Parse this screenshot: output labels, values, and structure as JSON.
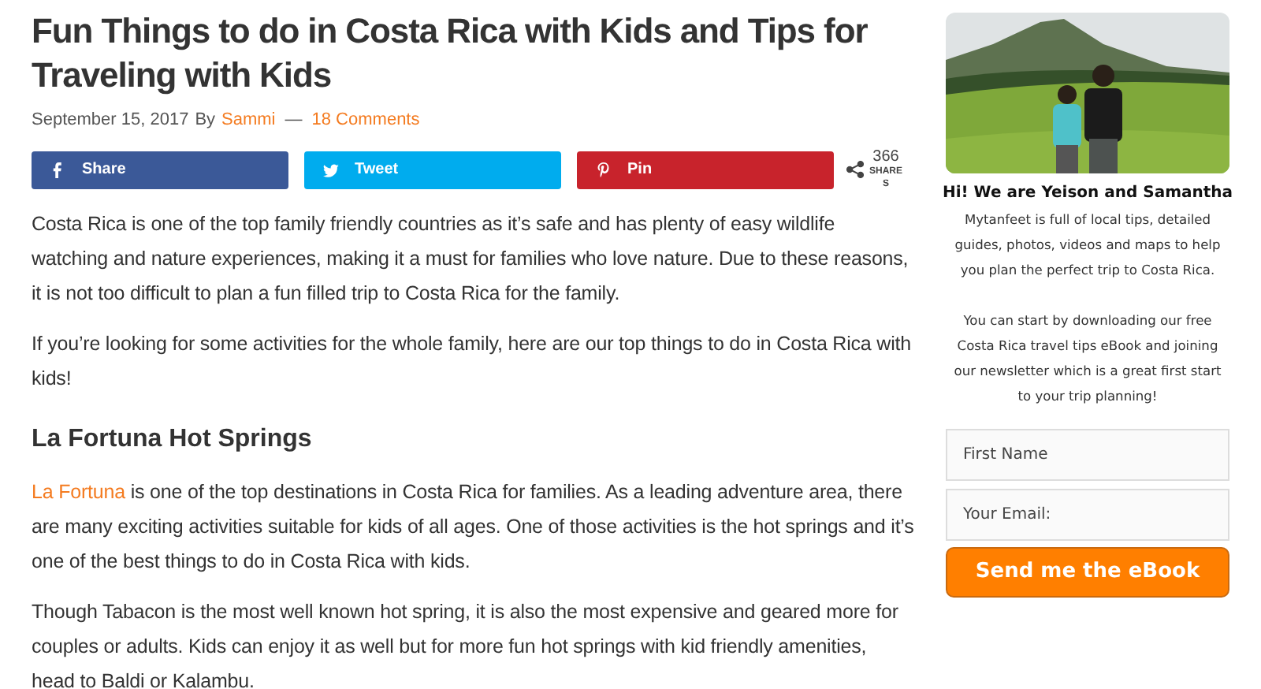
{
  "article": {
    "title": "Fun Things to do in Costa Rica with Kids and Tips for Traveling with Kids",
    "meta": {
      "date": "September 15, 2017",
      "by": "By",
      "author": "Sammi",
      "separator": "—",
      "comments": "18 Comments"
    },
    "share_buttons": [
      {
        "kind": "facebook",
        "label": "Share",
        "color": "#3b5998"
      },
      {
        "kind": "twitter",
        "label": "Tweet",
        "color": "#00acee"
      },
      {
        "kind": "pinterest",
        "label": "Pin",
        "color": "#c8232c"
      }
    ],
    "share_count": {
      "count": "366",
      "label": "SHARES"
    },
    "blocks": [
      {
        "kind": "paragraph",
        "text": "Costa Rica is one of the top family friendly countries as it’s safe and has plenty of easy wildlife watching and nature experiences, making it a must for families who love nature. Due to these reasons, it is not too difficult to plan a fun filled trip to Costa Rica for the family."
      },
      {
        "kind": "paragraph",
        "text": "If you’re looking for some activities for the whole family, here are our top things to do in Costa Rica with kids!"
      },
      {
        "kind": "heading",
        "text": "La Fortuna Hot Springs"
      },
      {
        "kind": "paragraph",
        "link": "La Fortuna",
        "text": " is one of the top destinations in Costa Rica for families. As a leading adventure area, there are many exciting activities suitable for kids of all ages. One of those activities is the hot springs and it’s one of the best things to do in Costa Rica with kids."
      },
      {
        "kind": "paragraph",
        "text": "Though Tabacon is the most well known hot spring, it is also the most expensive and geared more for couples or adults. Kids can enjoy it as well but for more fun hot springs with kid friendly amenities, head to Baldi or Kalambu."
      }
    ]
  },
  "sidebar": {
    "photo": {
      "kind": "picture"
    },
    "heading": "Hi! We are Yeison and Samantha",
    "paragraphs": [
      "Mytanfeet is full of local tips, detailed guides, photos, videos and maps to help you plan the perfect trip to Costa Rica.",
      "You can start by downloading our free Costa Rica travel tips eBook and joining our newsletter which is a great first start to your trip planning!"
    ],
    "fields": [
      {
        "placeholder": "First Name"
      },
      {
        "placeholder": "Your Email:"
      }
    ],
    "submit": "Send me the eBook"
  }
}
